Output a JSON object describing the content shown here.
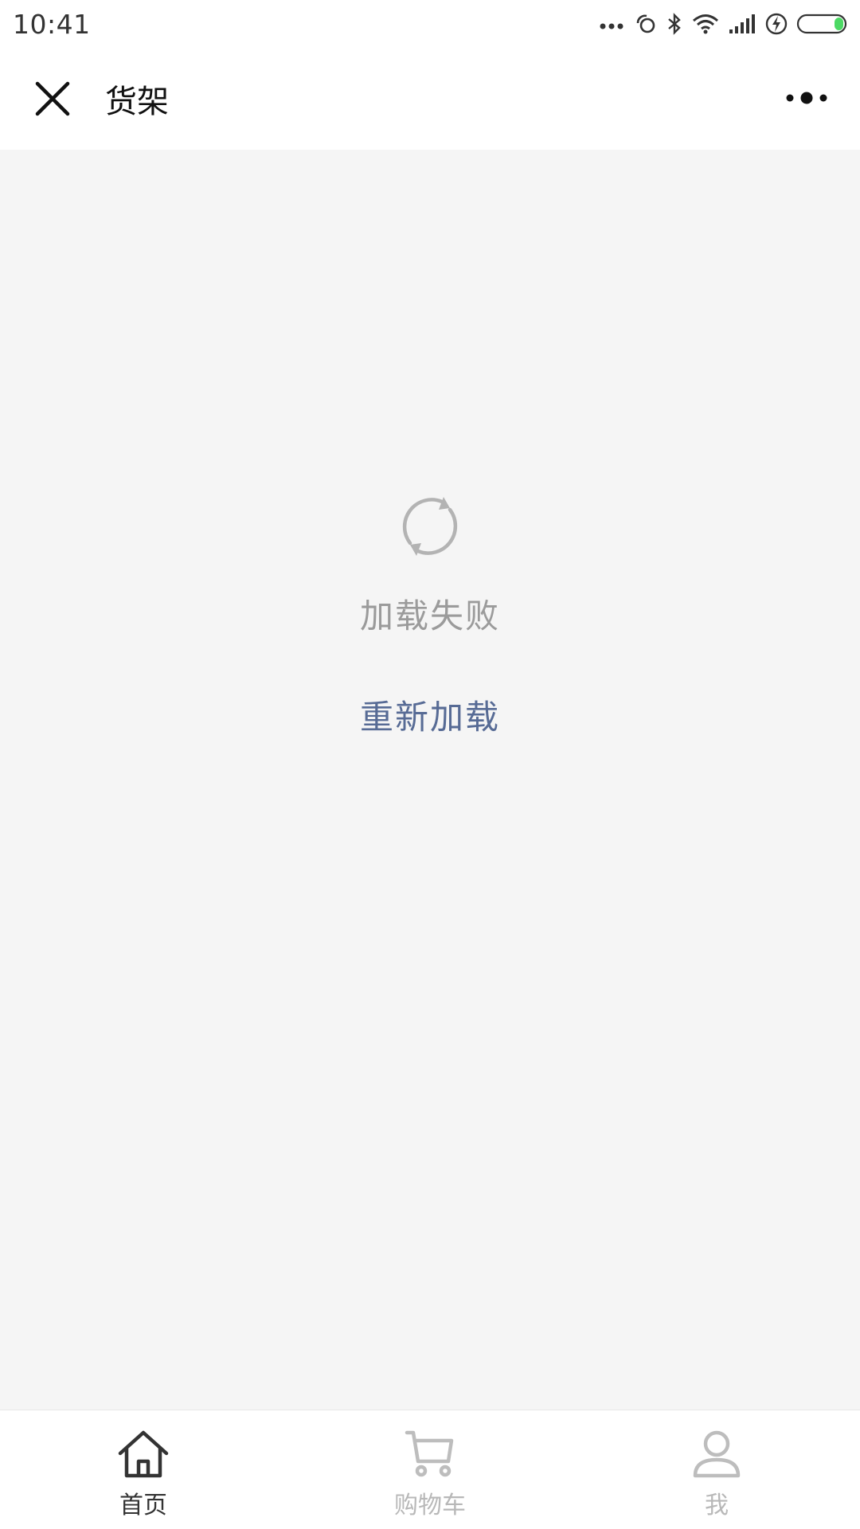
{
  "status_bar": {
    "time": "10:41",
    "icons": [
      "more-dots-icon",
      "link-icon",
      "bluetooth-icon",
      "wifi-icon",
      "signal-icon",
      "charging-icon",
      "battery-icon"
    ]
  },
  "nav": {
    "title": "货架",
    "close_icon": "close-icon",
    "more_icon": "more-icon"
  },
  "error": {
    "icon": "reload-icon",
    "message": "加载失败",
    "retry_label": "重新加载"
  },
  "tabs": [
    {
      "label": "首页",
      "icon": "home-icon",
      "active": true
    },
    {
      "label": "购物车",
      "icon": "cart-icon",
      "active": false
    },
    {
      "label": "我",
      "icon": "user-icon",
      "active": false
    }
  ],
  "colors": {
    "content_bg": "#f5f5f5",
    "link": "#576b95",
    "muted_text": "#9b9b9b",
    "battery_fill": "#4cd964"
  }
}
